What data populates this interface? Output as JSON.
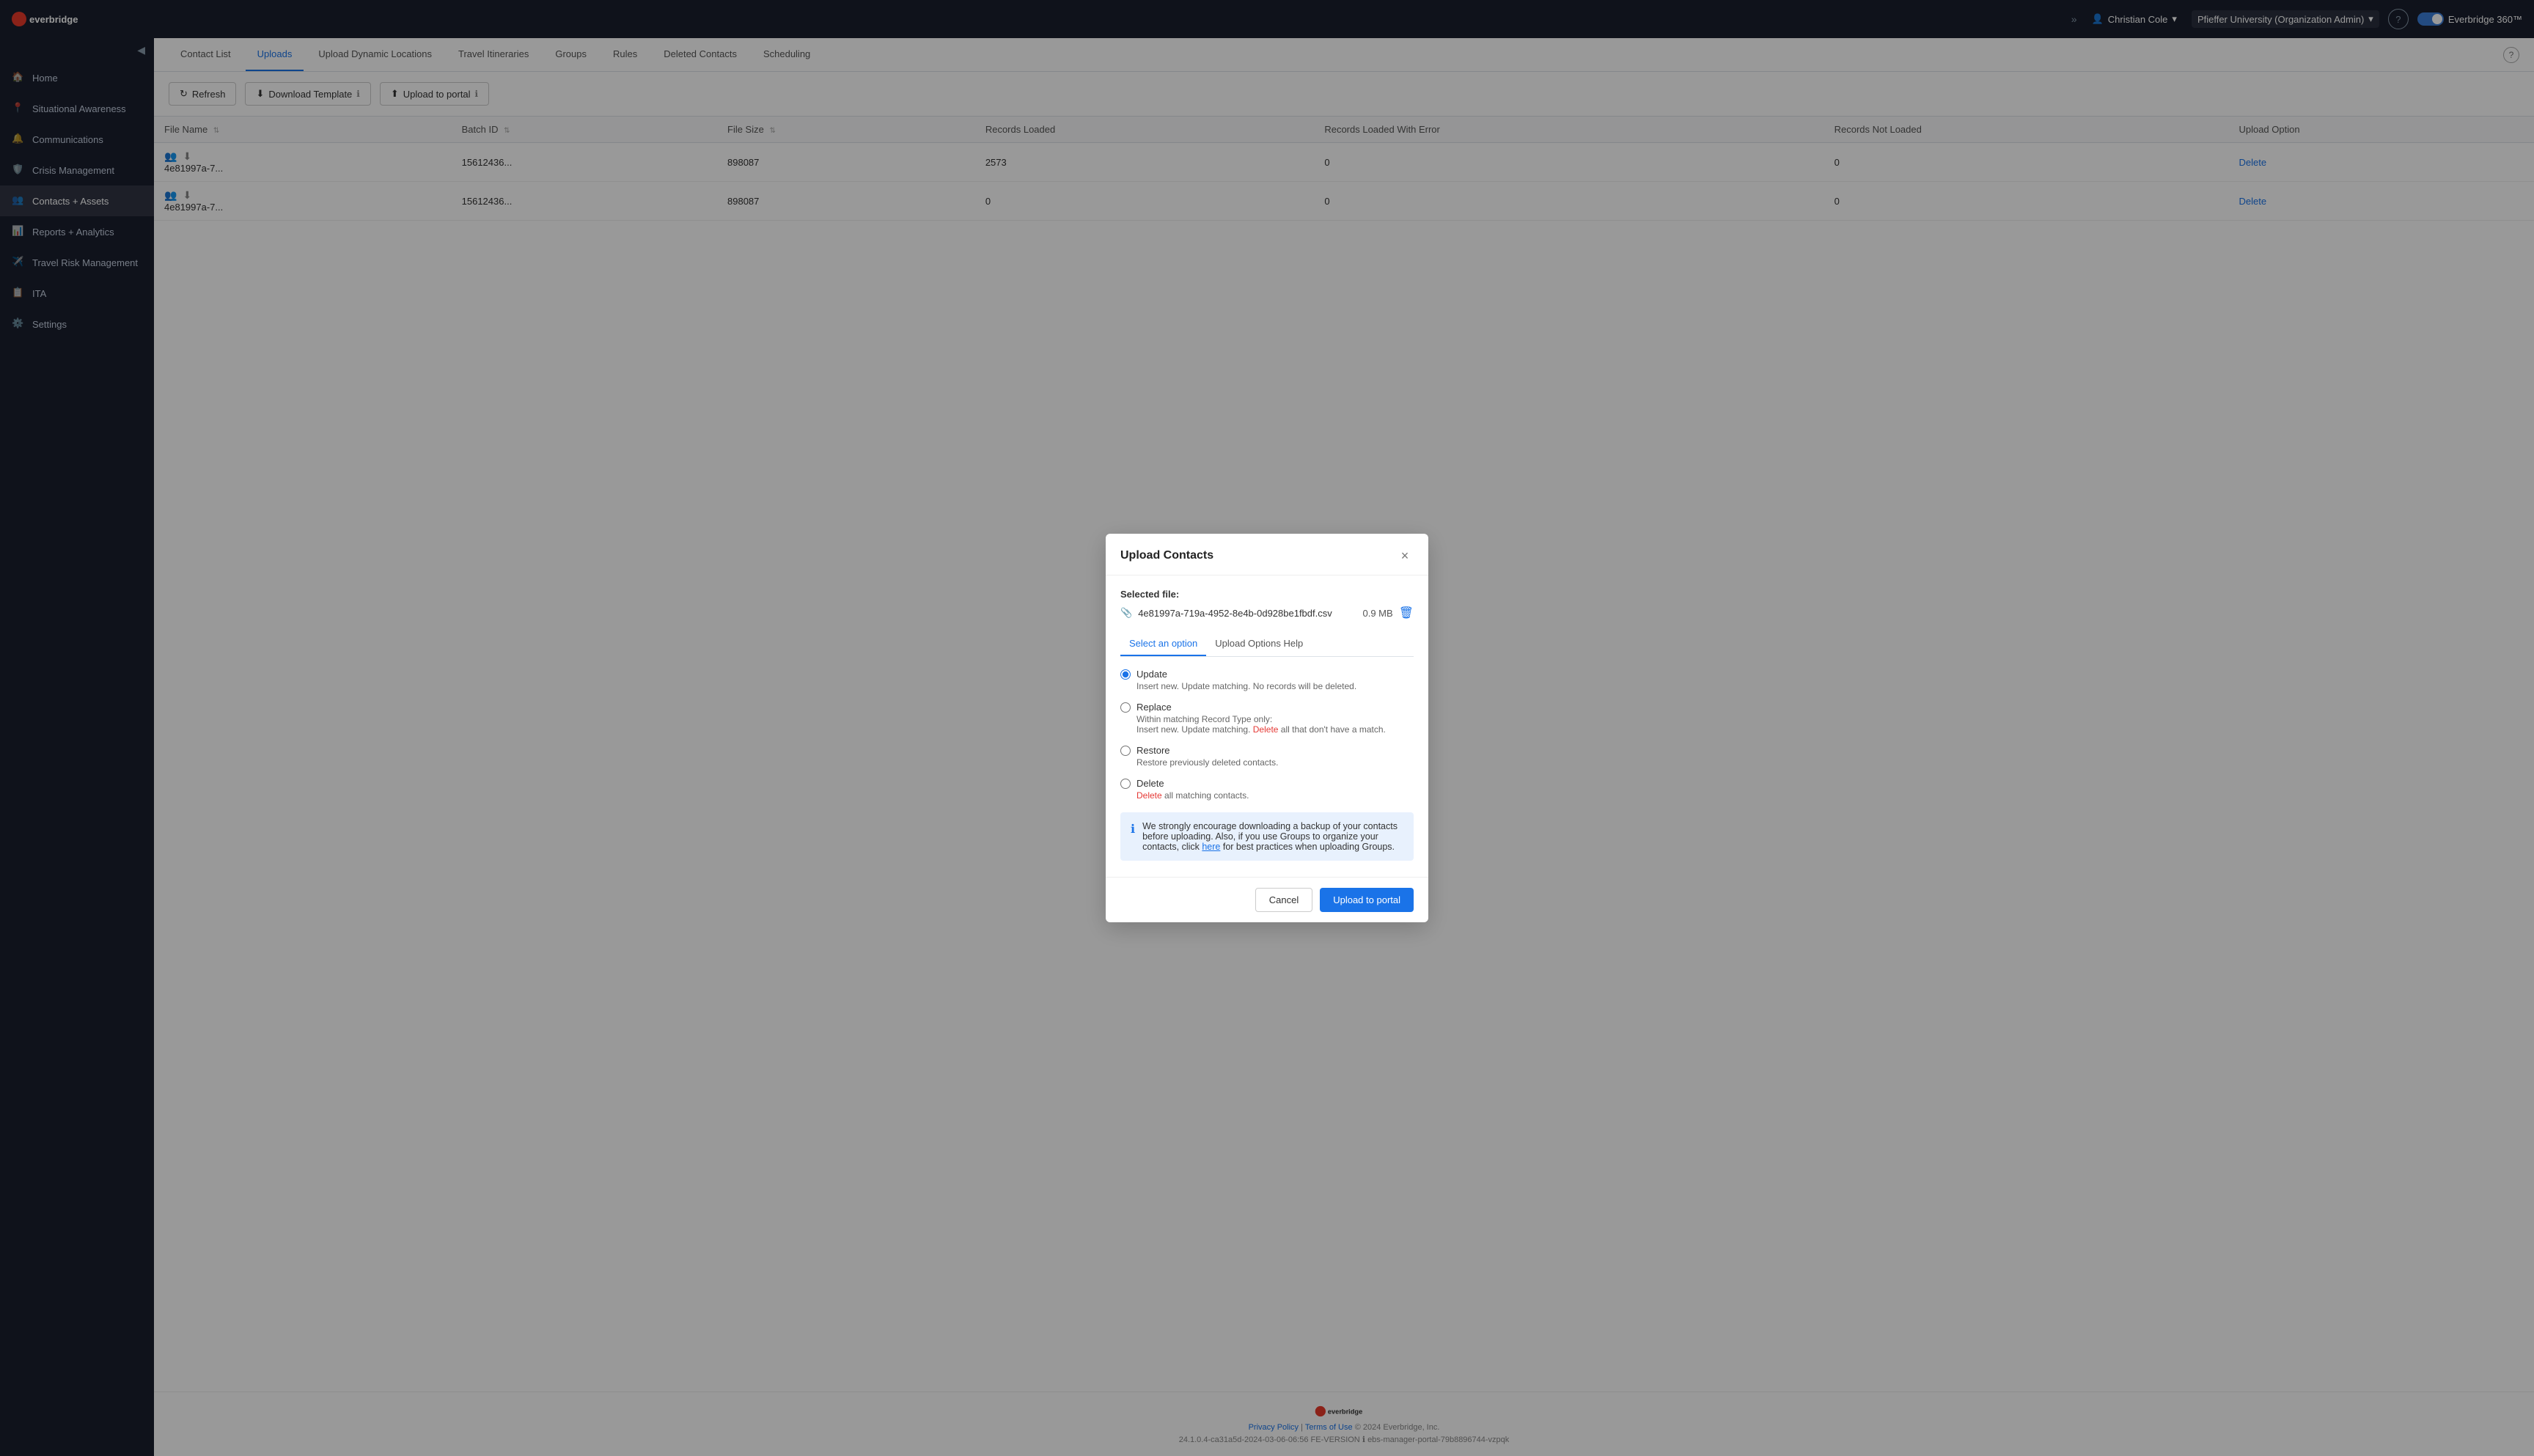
{
  "topNav": {
    "logo_alt": "Everbridge",
    "chevrons": "»",
    "user": {
      "name": "Christian Cole",
      "icon": "person-icon",
      "dropdown_icon": "chevron-down-icon"
    },
    "org": {
      "name": "Pfieffer University (Organization Admin)",
      "dropdown_icon": "chevron-down-icon"
    },
    "help_label": "?",
    "brand_label": "Everbridge 360™"
  },
  "sidebar": {
    "collapse_icon": "◀",
    "items": [
      {
        "id": "home",
        "label": "Home",
        "icon": "home-icon"
      },
      {
        "id": "situational-awareness",
        "label": "Situational Awareness",
        "icon": "map-icon"
      },
      {
        "id": "communications",
        "label": "Communications",
        "icon": "bell-icon"
      },
      {
        "id": "crisis-management",
        "label": "Crisis Management",
        "icon": "shield-icon"
      },
      {
        "id": "contacts-assets",
        "label": "Contacts + Assets",
        "icon": "contacts-icon"
      },
      {
        "id": "reports-analytics",
        "label": "Reports + Analytics",
        "icon": "chart-icon"
      },
      {
        "id": "travel-risk",
        "label": "Travel Risk Management",
        "icon": "travel-icon"
      },
      {
        "id": "ita",
        "label": "ITA",
        "icon": "ita-icon"
      },
      {
        "id": "settings",
        "label": "Settings",
        "icon": "gear-icon"
      }
    ]
  },
  "tabs": [
    {
      "id": "contact-list",
      "label": "Contact List",
      "active": false
    },
    {
      "id": "uploads",
      "label": "Uploads",
      "active": true
    },
    {
      "id": "upload-dynamic",
      "label": "Upload Dynamic Locations",
      "active": false
    },
    {
      "id": "travel-itineraries",
      "label": "Travel Itineraries",
      "active": false
    },
    {
      "id": "groups",
      "label": "Groups",
      "active": false
    },
    {
      "id": "rules",
      "label": "Rules",
      "active": false
    },
    {
      "id": "deleted-contacts",
      "label": "Deleted Contacts",
      "active": false
    },
    {
      "id": "scheduling",
      "label": "Scheduling",
      "active": false
    }
  ],
  "toolbar": {
    "refresh_label": "Refresh",
    "download_template_label": "Download Template",
    "upload_portal_label": "Upload to portal"
  },
  "table": {
    "columns": [
      {
        "id": "file-name",
        "label": "File Name"
      },
      {
        "id": "batch-id",
        "label": "Batch ID"
      },
      {
        "id": "file-size",
        "label": "File Size"
      },
      {
        "id": "records-loaded",
        "label": "Records Loaded"
      },
      {
        "id": "records-loaded-error",
        "label": "Records Loaded With Error"
      },
      {
        "id": "records-not-loaded",
        "label": "Records Not Loaded"
      },
      {
        "id": "upload-option",
        "label": "Upload Option"
      }
    ],
    "rows": [
      {
        "file_name": "4e81997a-7...",
        "batch_id": "15612436...",
        "file_size": "898087",
        "records_loaded": "2573",
        "records_loaded_error": "0",
        "records_not_loaded": "0",
        "upload_option": "Delete"
      },
      {
        "file_name": "4e81997a-7...",
        "batch_id": "15612436...",
        "file_size": "898087",
        "records_loaded": "0",
        "records_loaded_error": "0",
        "records_not_loaded": "0",
        "upload_option": "Delete"
      }
    ]
  },
  "modal": {
    "title": "Upload Contacts",
    "close_label": "×",
    "selected_file_label": "Selected file:",
    "file_name": "4e81997a-719a-4952-8e4b-0d928be1fbdf.csv",
    "file_size": "0.9 MB",
    "option_tabs": [
      {
        "id": "select-option",
        "label": "Select an option",
        "active": true
      },
      {
        "id": "upload-help",
        "label": "Upload Options Help",
        "active": false
      }
    ],
    "options": [
      {
        "id": "update",
        "label": "Update",
        "description": "Insert new. Update matching. No records will be deleted.",
        "checked": true,
        "has_delete_text": false
      },
      {
        "id": "replace",
        "label": "Replace",
        "description_parts": [
          {
            "text": "Within matching Record Type only:",
            "delete": false
          },
          {
            "text": " Insert new. Update matching. ",
            "delete": false
          },
          {
            "text": "Delete",
            "delete": true
          },
          {
            "text": " all that don't have a match.",
            "delete": false
          }
        ],
        "checked": false
      },
      {
        "id": "restore",
        "label": "Restore",
        "description": "Restore previously deleted contacts.",
        "checked": false,
        "has_delete_text": false
      },
      {
        "id": "delete",
        "label": "Delete",
        "description_prefix": "",
        "description_delete": "Delete",
        "description_suffix": " all matching contacts.",
        "checked": false
      }
    ],
    "info_text": "We strongly encourage downloading a backup of your contacts before uploading. Also, if you use Groups to organize your contacts, click ",
    "info_link_text": "here",
    "info_text_suffix": " for best practices when uploading Groups.",
    "cancel_label": "Cancel",
    "upload_label": "Upload to portal"
  },
  "footer": {
    "privacy_policy": "Privacy Policy",
    "terms_of_use": "Terms of Use",
    "copyright": "© 2024 Everbridge, Inc.",
    "version": "24.1.0.4-ca31a5d-2024-03-06-06:56",
    "fe_version": "FE-VERSION",
    "server": "ebs-manager-portal-79b8896744-vzpqk"
  }
}
